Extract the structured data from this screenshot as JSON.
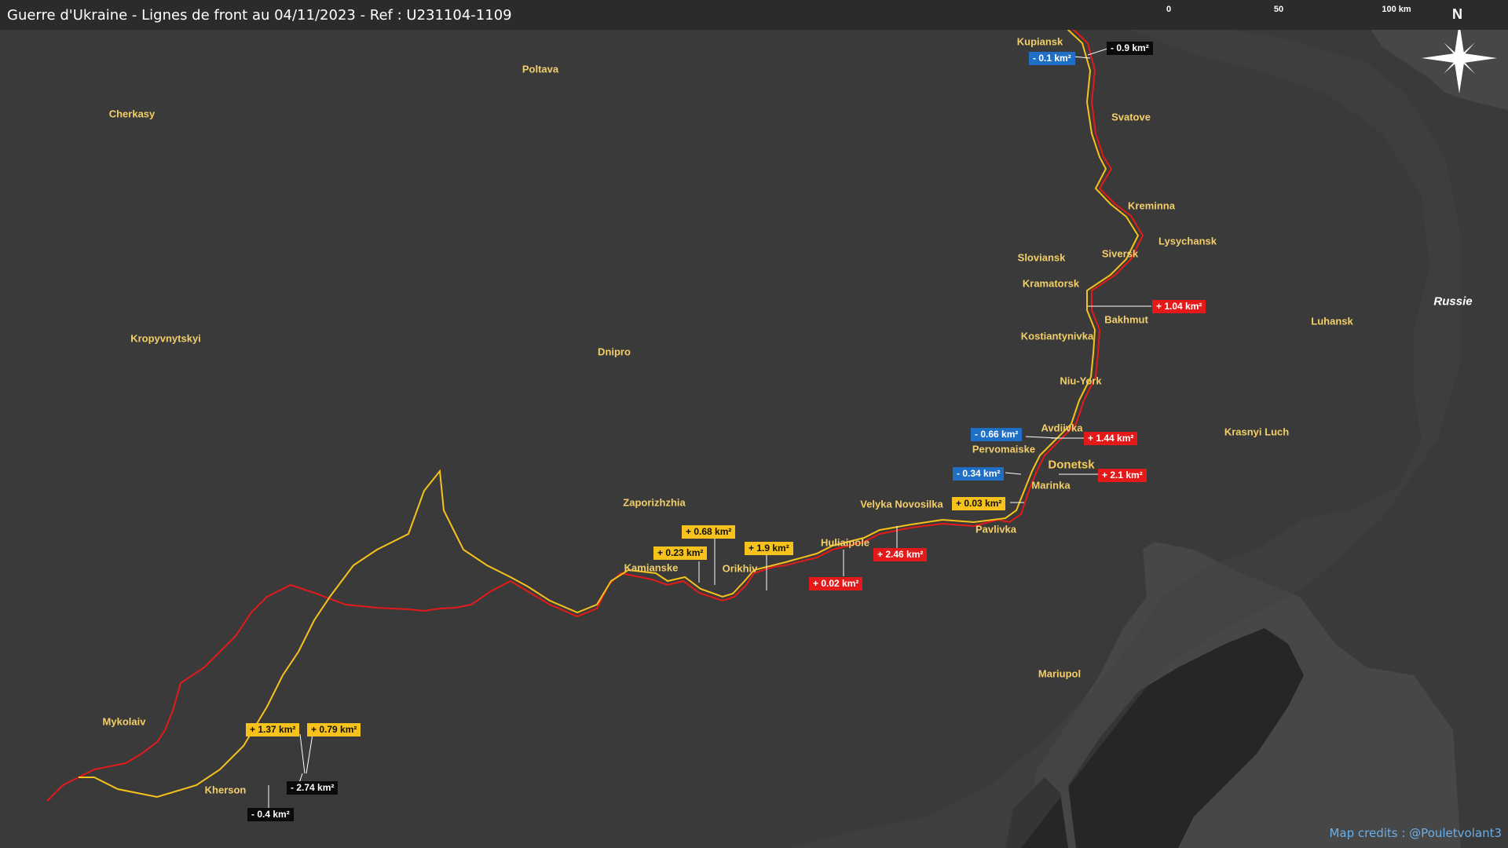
{
  "title": "Guerre d'Ukraine - Lignes de front au 04/11/2023 - Ref : U231104-1109",
  "credits": "Map credits : @Pouletvolant3",
  "compass_label": "N",
  "scale": {
    "labels": [
      "0",
      "50",
      "100 km"
    ]
  },
  "colors": {
    "background": "#3a3a3a",
    "russia_land": "#474747",
    "sea": "#262626",
    "line_red": "#e41a1a",
    "line_yellow": "#f6c21b"
  },
  "country_label": "Russie",
  "cities": [
    "Kupiansk",
    "Poltava",
    "Cherkasy",
    "Svatove",
    "Kreminna",
    "Lysychansk",
    "Siversk",
    "Sloviansk",
    "Kramatorsk",
    "Bakhmut",
    "Luhansk",
    "Kostiantynivka",
    "Kropyvnytskyi",
    "Dnipro",
    "Niu-York",
    "Avdiivka",
    "Pervomaiske",
    "Krasnyi Luch",
    "Donetsk",
    "Marinka",
    "Zaporizhzhia",
    "Velyka Novosilka",
    "Pavlivka",
    "Huliaipole",
    "Kamianske",
    "Orikhiv",
    "Mariupol",
    "Mykolaiv",
    "Kherson"
  ],
  "changes": [
    {
      "label": "- 0.9 km²",
      "type": "black"
    },
    {
      "label": "- 0.1 km²",
      "type": "blue"
    },
    {
      "label": "+ 1.04 km²",
      "type": "red"
    },
    {
      "label": "- 0.66 km²",
      "type": "blue"
    },
    {
      "label": "+ 1.44 km²",
      "type": "red"
    },
    {
      "label": "- 0.34 km²",
      "type": "blue"
    },
    {
      "label": "+ 2.1 km²",
      "type": "red"
    },
    {
      "label": "+ 0.03 km²",
      "type": "yellow"
    },
    {
      "label": "+ 2.46 km²",
      "type": "red"
    },
    {
      "label": "+ 0.02 km²",
      "type": "red"
    },
    {
      "label": "+ 0.68 km²",
      "type": "yellow"
    },
    {
      "label": "+ 0.23 km²",
      "type": "yellow"
    },
    {
      "label": "+ 1.9 km²",
      "type": "yellow"
    },
    {
      "label": "+ 1.37 km²",
      "type": "yellow"
    },
    {
      "label": "+ 0.79 km²",
      "type": "yellow"
    },
    {
      "label": "- 2.74 km²",
      "type": "black"
    },
    {
      "label": "- 0.4 km²",
      "type": "black"
    }
  ]
}
